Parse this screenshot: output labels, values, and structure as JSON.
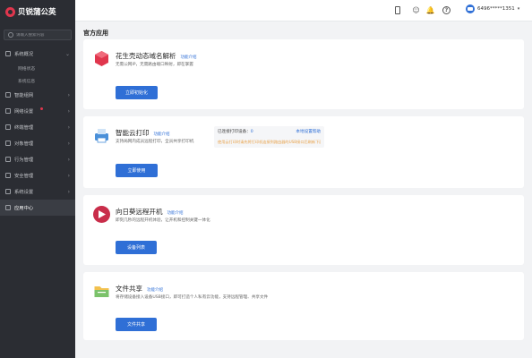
{
  "app": {
    "brand": "贝锐蒲公英"
  },
  "search": {
    "placeholder": "请输入搜索内容"
  },
  "sidebar": {
    "items": [
      {
        "label": "系统概况",
        "subs": [
          "网络状态",
          "系统信息"
        ]
      },
      {
        "label": "智能组网"
      },
      {
        "label": "网络设置",
        "badge": true
      },
      {
        "label": "终端管理"
      },
      {
        "label": "对象管理"
      },
      {
        "label": "行为管理"
      },
      {
        "label": "安全管理"
      },
      {
        "label": "系统设置"
      },
      {
        "label": "应用中心",
        "active": true
      }
    ]
  },
  "header": {
    "username": "6496*****1351"
  },
  "main": {
    "section_title": "官方应用",
    "cards": [
      {
        "title": "花生壳动态域名解析",
        "link": "功能介绍",
        "desc": "无需公网IP，无需路由端口映射，即在掌握",
        "button": "立即初始化"
      },
      {
        "title": "智能云打印",
        "link": "功能介绍",
        "desc": "支持局网内成员远程打印，全员共享打印机",
        "button": "立即使用",
        "info": {
          "devices_label": "已连接打印设备：",
          "devices_count": "0",
          "help": "本地设置帮助",
          "warning": "使用云打印时请先将打印机连接到路由器的USB接口后刷新下面"
        }
      },
      {
        "title": "向日葵远程开机",
        "link": "功能介绍",
        "desc": "即刻几秒的远程开机体验，让开机和控制关键一体化",
        "button": "设备列表"
      },
      {
        "title": "文件共享",
        "link": "功能介绍",
        "desc": "将存储设备接入设备USB接口，即可打造个人私有云功能，支持远程管理、共享文件",
        "button": "文件共享"
      }
    ]
  },
  "colors": {
    "accent": "#2f6fd6",
    "sidebar_bg": "#2b2d33",
    "brand": "#e0364d",
    "warning": "#e8a24a"
  }
}
